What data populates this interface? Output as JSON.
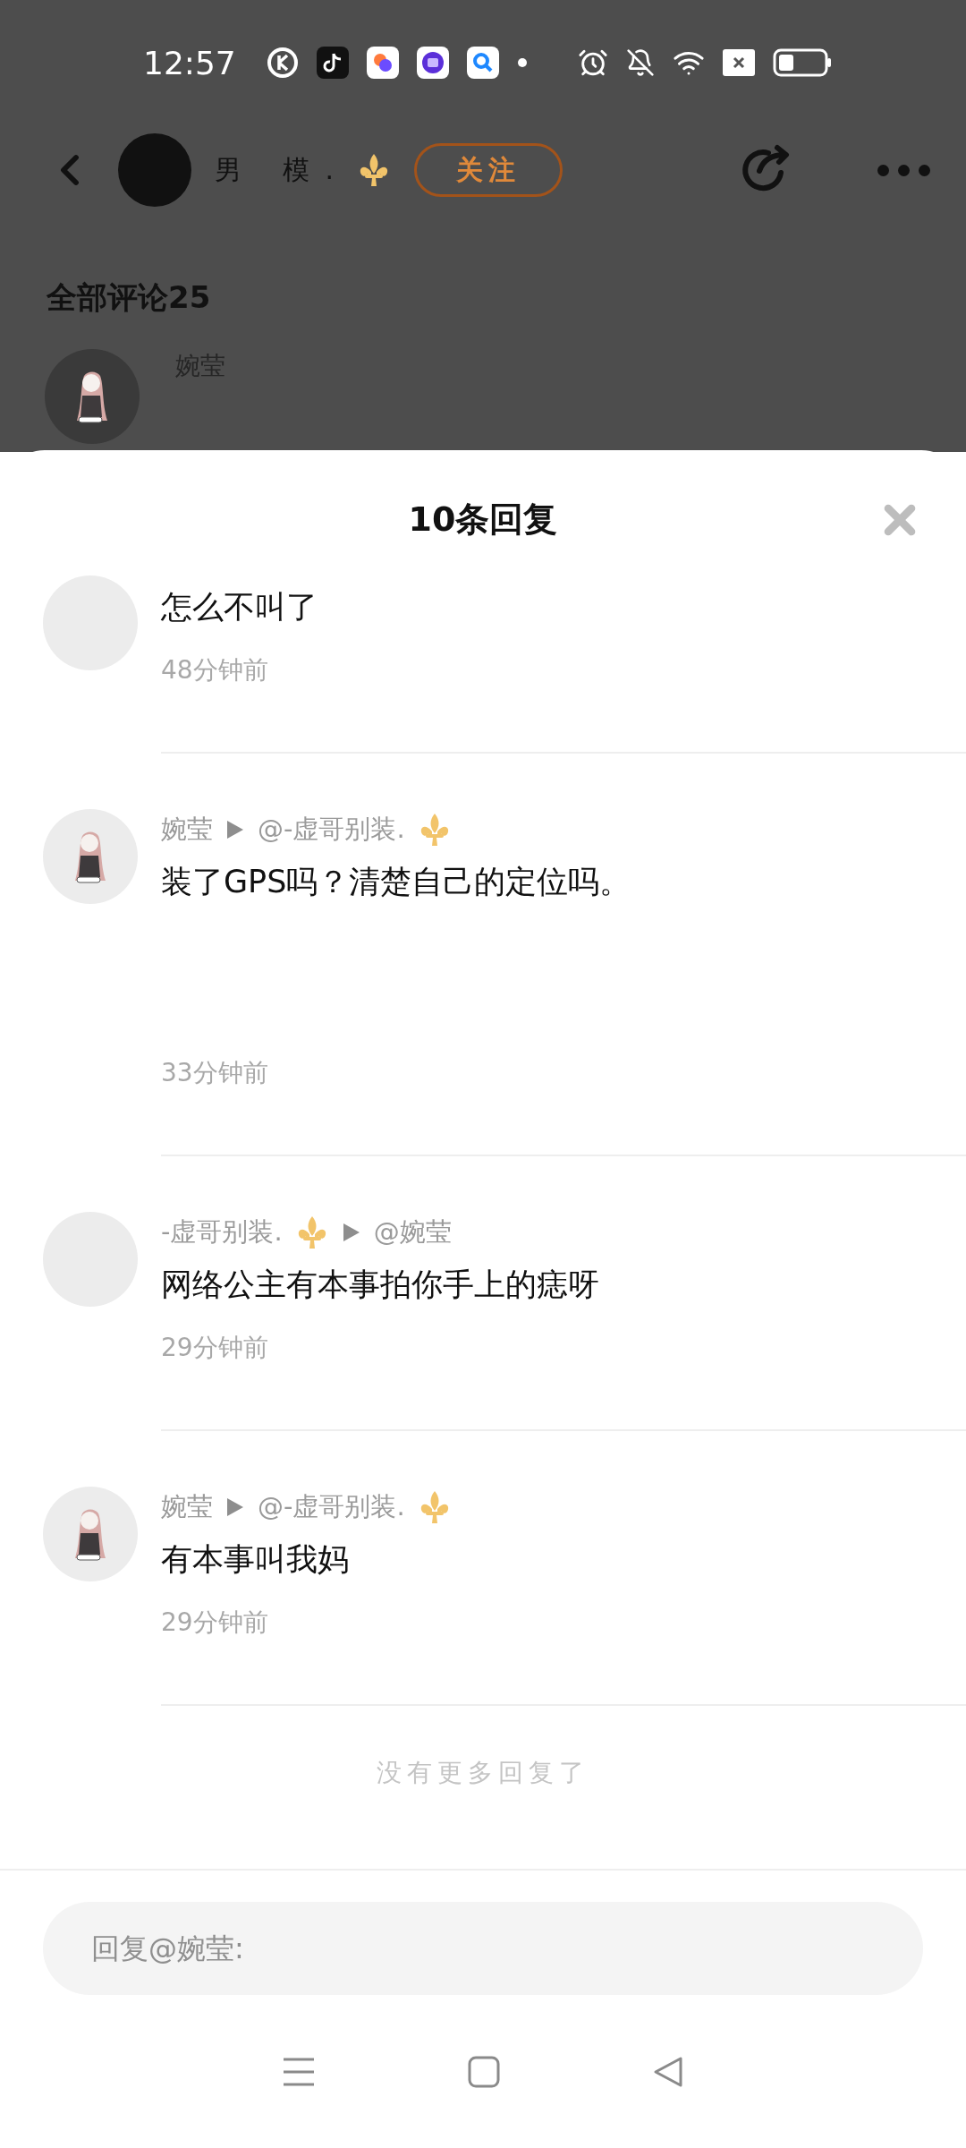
{
  "status_bar": {
    "time": "12:57"
  },
  "header": {
    "author_name": "男 模.",
    "author_badge": true,
    "follow_label": "关注"
  },
  "comments_heading": "全部评论25",
  "background_comment": {
    "author": "婉莹",
    "avatar_picture": true
  },
  "reply_sheet": {
    "title": "10条回复",
    "replies": [
      {
        "avatar_picture": false,
        "text": "怎么不叫了",
        "time": "48分钟前"
      },
      {
        "avatar_picture": true,
        "author": "婉莹",
        "author_badge": false,
        "target": "@-虚哥别装.",
        "target_badge": true,
        "text": "装了GPS吗？清楚自己的定位吗。",
        "time": "33分钟前",
        "tall": true
      },
      {
        "avatar_picture": false,
        "author": "-虚哥别装.",
        "author_badge": true,
        "target": "@婉莹",
        "target_badge": false,
        "text": "网络公主有本事拍你手上的痣呀",
        "time": "29分钟前",
        "tall": false
      },
      {
        "avatar_picture": true,
        "author": "婉莹",
        "author_badge": false,
        "target": "@-虚哥别装.",
        "target_badge": true,
        "text": "有本事叫我妈",
        "time": "29分钟前",
        "tall": false
      }
    ],
    "end_note": "没有更多回复了"
  },
  "reply_input": {
    "placeholder": "回复@婉莹:"
  }
}
